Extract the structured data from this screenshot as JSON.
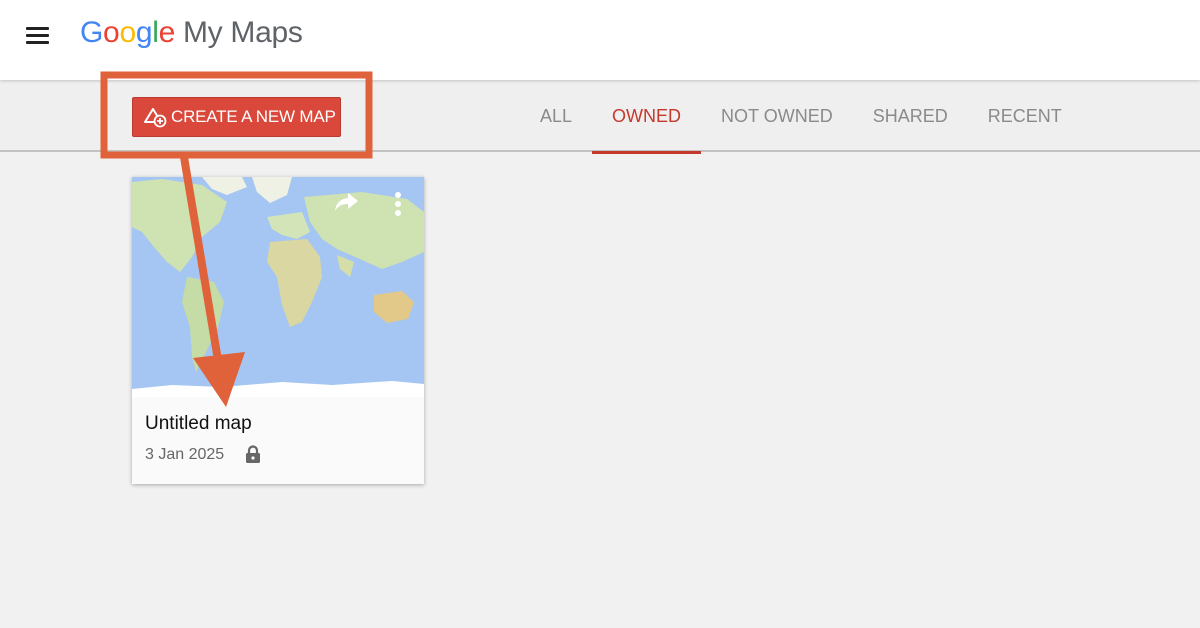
{
  "header": {
    "logo_letters": [
      "G",
      "o",
      "o",
      "g",
      "l",
      "e"
    ],
    "product_name": "My Maps",
    "menu_icon": "hamburger-menu-icon"
  },
  "toolbar": {
    "create_button_label": "CREATE A NEW MAP",
    "create_button_icon": "add-map-icon",
    "create_button_color": "#d9483b",
    "tabs": [
      {
        "label": "ALL",
        "active": false
      },
      {
        "label": "OWNED",
        "active": true
      },
      {
        "label": "NOT OWNED",
        "active": false
      },
      {
        "label": "SHARED",
        "active": false
      },
      {
        "label": "RECENT",
        "active": false
      }
    ],
    "active_tab_color": "#c5392d"
  },
  "maps": [
    {
      "title": "Untitled map",
      "date": "3 Jan 2025",
      "privacy_icon": "lock-icon",
      "actions": [
        "share-icon",
        "more-vert-icon"
      ]
    }
  ],
  "annotation": {
    "color": "#e0623a",
    "highlight": "create-new-map-button",
    "arrow_target": "map-card"
  }
}
